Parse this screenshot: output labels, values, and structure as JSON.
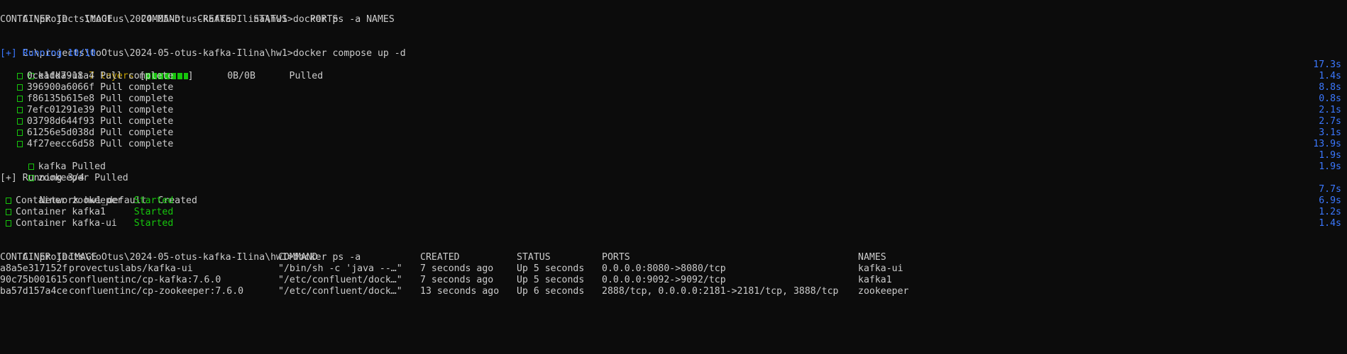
{
  "terminal": {
    "prompt": "C:\\projects\\toOtus\\2024-05-otus-kafka-Ilina\\hw1>",
    "first_cmd": "docker ps -a",
    "first_header": "CONTAINER ID   IMAGE     COMMAND   CREATED   STATUS    PORTS     NAMES",
    "second_cmd": "docker compose up -d",
    "running1": "[+] Running 10/10",
    "kafka_ui_line": {
      "name": "kafka-ui",
      "layers": "7 layers",
      "sizes": "0B/0B",
      "status": "Pulled",
      "time": "17.3s"
    },
    "layers": [
      {
        "id": "0ce1dd7918a4",
        "status": "Pull complete",
        "time": "1.4s"
      },
      {
        "id": "396900a6066f",
        "status": "Pull complete",
        "time": "8.8s"
      },
      {
        "id": "f86135b615e8",
        "status": "Pull complete",
        "time": "0.8s"
      },
      {
        "id": "7efc01291e39",
        "status": "Pull complete",
        "time": "2.1s"
      },
      {
        "id": "03798d644f93",
        "status": "Pull complete",
        "time": "2.7s"
      },
      {
        "id": "61256e5d038d",
        "status": "Pull complete",
        "time": "3.1s"
      },
      {
        "id": "4f27eecc6d58",
        "status": "Pull complete",
        "time": "13.9s"
      }
    ],
    "kafka_pulled": {
      "text": "kafka Pulled",
      "time": "1.9s"
    },
    "zookeeper_pulled": {
      "text": "zookeeper Pulled",
      "time": "1.9s"
    },
    "running2": "[+] Running 3/4",
    "network": {
      "text": "- Network hw1_default  Created",
      "time": "7.7s"
    },
    "containers": [
      {
        "prefix": "Container zookeeper",
        "status": "Started",
        "time": "6.9s"
      },
      {
        "prefix": "Container kafka1   ",
        "status": "Started",
        "time": "1.2s"
      },
      {
        "prefix": "Container kafka-ui ",
        "status": "Started",
        "time": "1.4s"
      }
    ],
    "third_cmd": "docker ps -a",
    "table": {
      "headers": [
        "CONTAINER ID",
        "IMAGE",
        "COMMAND",
        "CREATED",
        "STATUS",
        "PORTS",
        "NAMES"
      ],
      "rows": [
        [
          "a8a5e317152f",
          "provectuslabs/kafka-ui",
          "\"/bin/sh -c 'java --…\"",
          "7 seconds ago",
          "Up 5 seconds",
          "0.0.0.0:8080->8080/tcp",
          "kafka-ui"
        ],
        [
          "90c75b001615",
          "confluentinc/cp-kafka:7.6.0",
          "\"/etc/confluent/dock…\"",
          "7 seconds ago",
          "Up 5 seconds",
          "0.0.0.0:9092->9092/tcp",
          "kafka1"
        ],
        [
          "ba57d157a4ce",
          "confluentinc/cp-zookeeper:7.6.0",
          "\"/etc/confluent/dock…\"",
          "13 seconds ago",
          "Up 6 seconds",
          "2888/tcp, 0.0.0.0:2181->2181/tcp, 3888/tcp",
          "zookeeper"
        ]
      ]
    }
  },
  "colors": {
    "background": "#0c0c0c",
    "text": "#cccccc",
    "green": "#16c60c",
    "blue": "#3b78ff",
    "yellow": "#c19c00"
  }
}
